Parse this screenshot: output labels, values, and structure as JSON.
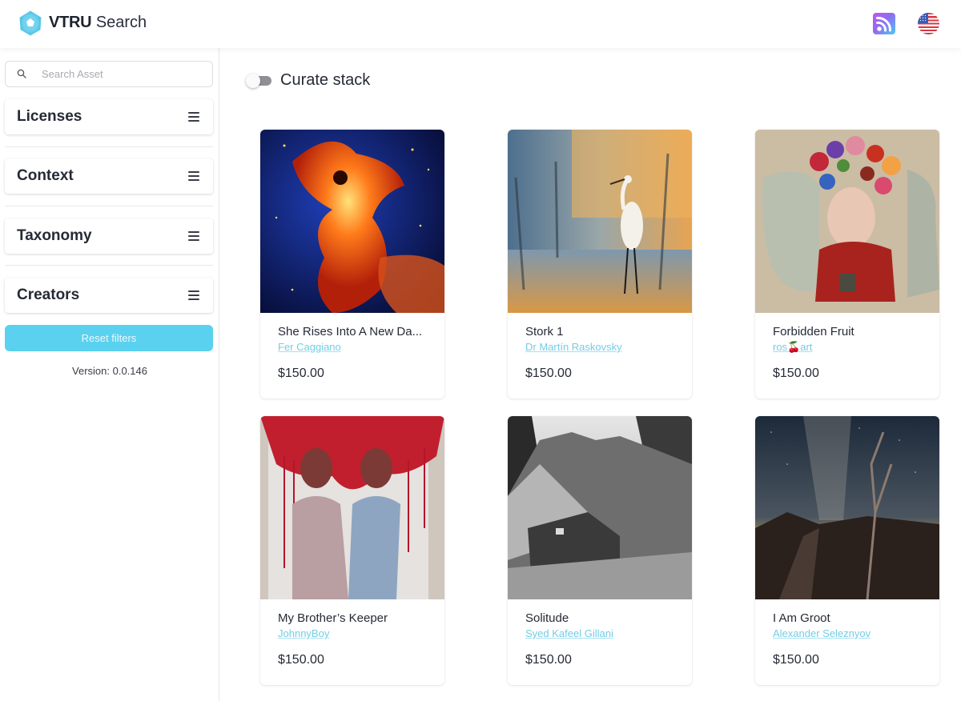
{
  "header": {
    "brand_bold": "VTRU",
    "brand_light": "Search",
    "icons": {
      "logo": "vtru-logo-icon",
      "rss": "rss-feed-icon",
      "language": "us-flag-icon"
    }
  },
  "sidebar": {
    "search": {
      "placeholder": "Search Asset",
      "value": "",
      "icon": "search-icon"
    },
    "filters": [
      {
        "label": "Licenses",
        "icon": "menu-icon"
      },
      {
        "label": "Context",
        "icon": "menu-icon"
      },
      {
        "label": "Taxonomy",
        "icon": "menu-icon"
      },
      {
        "label": "Creators",
        "icon": "menu-icon"
      }
    ],
    "reset_label": "Reset filters",
    "version": "Version: 0.0.146"
  },
  "main": {
    "curate_toggle": {
      "label": "Curate stack",
      "on": false
    },
    "assets": [
      {
        "title": "She Rises Into A New Da...",
        "creator": "Fer Caggiano",
        "price": "$150.00",
        "art": "fiery-figure-artwork"
      },
      {
        "title": "Stork 1",
        "creator": "Dr Martín Raskovsky",
        "price": "$150.00",
        "art": "stork-painting-artwork"
      },
      {
        "title": "Forbidden Fruit",
        "creator": "ros🍒art",
        "price": "$150.00",
        "art": "floral-portrait-artwork"
      },
      {
        "title": "My Brother’s Keeper",
        "creator": "JohnnyBoy",
        "price": "$150.00",
        "art": "red-drip-portrait-artwork"
      },
      {
        "title": "Solitude",
        "creator": "Syed Kafeel Gillani",
        "price": "$150.00",
        "art": "monochrome-hut-photo"
      },
      {
        "title": "I Am Groot",
        "creator": "Alexander Seleznyov",
        "price": "$150.00",
        "art": "milky-way-tree-photo"
      }
    ]
  },
  "colors": {
    "accent": "#5ad1ef",
    "link": "#72cde6",
    "text": "#262a36"
  }
}
